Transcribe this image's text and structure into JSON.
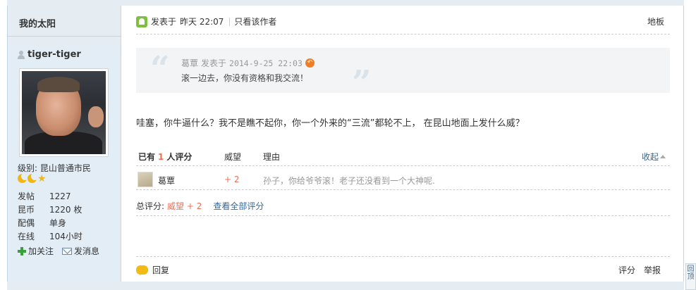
{
  "sidebar": {
    "forum_title": "我的太阳",
    "username": "tiger-tiger",
    "level_label": "级别:",
    "level_value": "昆山普通市民",
    "stats": [
      {
        "key": "发帖",
        "value": "1227"
      },
      {
        "key": "昆币",
        "value": "1220 枚"
      },
      {
        "key": "配偶",
        "value": "单身"
      },
      {
        "key": "在线",
        "value": "104小时"
      }
    ],
    "follow_label": "加关注",
    "message_label": "发消息"
  },
  "post": {
    "posted_label": "发表于",
    "posted_time": "昨天 22:07",
    "author_only_label": "只看该作者",
    "floor_label": "地板",
    "quote": {
      "author": "葛覃",
      "posted_label": "发表于",
      "time": "2014-9-25 22:03",
      "text": "滚一边去，你没有资格和我交流！"
    },
    "body": "哇塞，你牛逼什么？我不是瞧不起你，你一个外来的“三流”都轮不上，  在昆山地面上发什么威？"
  },
  "rating": {
    "prefix": "已有",
    "count": "1",
    "suffix": "人评分",
    "col_weiwang": "威望",
    "col_reason": "理由",
    "collapse_label": "收起",
    "rows": [
      {
        "user": "葛覃",
        "score": "+ 2",
        "reason": "孙子，你给爷爷滚！老子还没看到一个大神呢."
      }
    ],
    "total_label": "总评分:",
    "total_value": "威望 + 2",
    "view_all_label": "查看全部评分"
  },
  "footer": {
    "reply_label": "回复",
    "rate_label": "评分",
    "report_label": "举报"
  },
  "back_to_top": "回顶"
}
